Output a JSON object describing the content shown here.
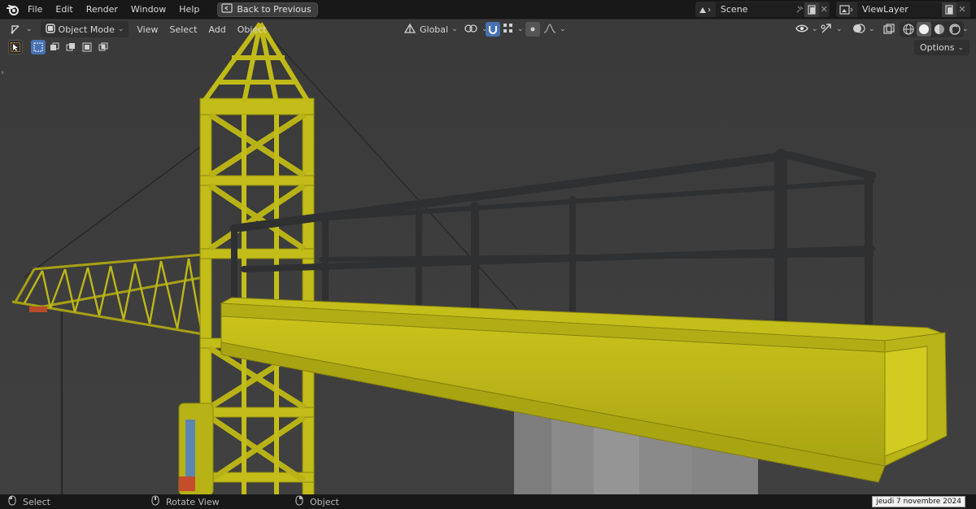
{
  "menubar": {
    "items": [
      "File",
      "Edit",
      "Render",
      "Window",
      "Help"
    ],
    "back_button": "Back to Previous",
    "scene": {
      "label": "Scene"
    },
    "view_layer": {
      "label": "ViewLayer"
    }
  },
  "viewport_header": {
    "mode": "Object Mode",
    "menus": [
      "View",
      "Select",
      "Add",
      "Object"
    ],
    "orientation": "Global",
    "options_label": "Options"
  },
  "statusbar": {
    "select": "Select",
    "rotate": "Rotate View",
    "object": "Object",
    "date": "jeudi 7 novembre 2024"
  },
  "colors": {
    "accent": "#4772b3",
    "viewport_bg": "#3d3d3d",
    "crane_yellow": "#c8c21a",
    "rail_dark": "#2f3032"
  }
}
